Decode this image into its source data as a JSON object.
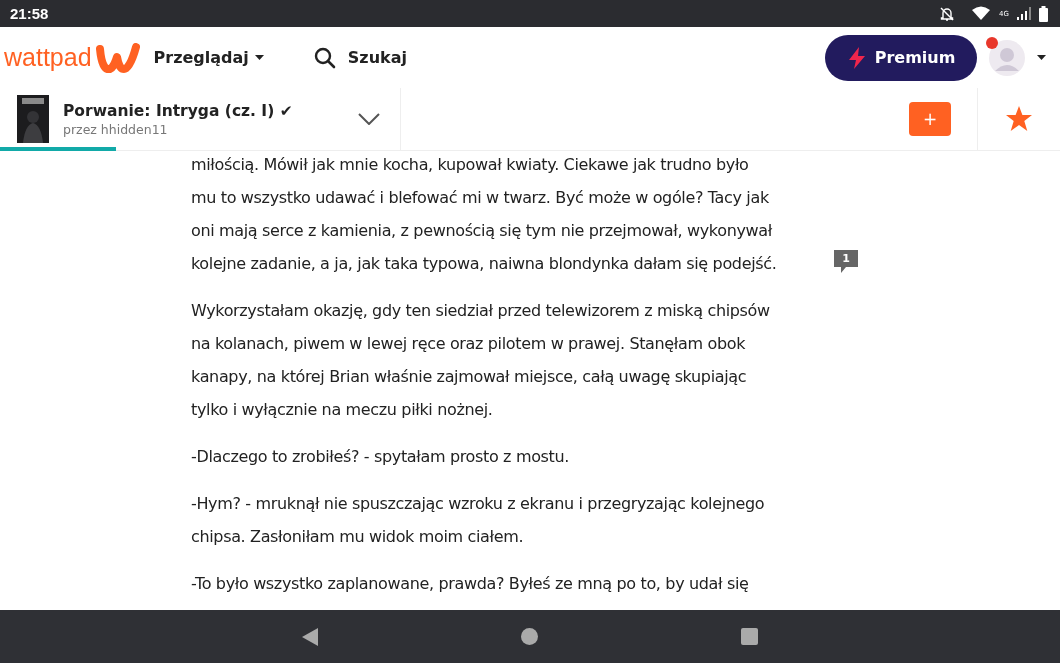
{
  "status_bar": {
    "time": "21:58",
    "network": "4G"
  },
  "header": {
    "logo": "wattpad",
    "browse": "Przeglądaj",
    "search": "Szukaj",
    "premium": "Premium",
    "notification": true
  },
  "story": {
    "title": "Porwanie: Intryga (cz. I)",
    "check": "✔",
    "author": "przez hhidden11",
    "progress": {
      "level": 0.29
    },
    "add": "+"
  },
  "paragraphs": [
    {
      "lines": [
        "miłością. Mówił jak mnie kocha, kupował kwiaty. Ciekawe jak trudno było",
        "mu to wszystko udawać i blefować mi w twarz. Być może w ogóle? Tacy jak",
        "oni mają serce z kamienia, z pewnością się tym nie przejmował, wykonywał",
        "kolejne zadanie, a ja, jak taka typowa, naiwna blondynka dałam się podejść."
      ],
      "comments": "1"
    },
    {
      "lines": [
        "Wykorzystałam okazję, gdy ten siedział przed telewizorem z miską chipsów",
        "na kolanach, piwem w lewej ręce oraz pilotem w prawej. Stanęłam obok",
        "kanapy, na której Brian właśnie zajmował miejsce, całą uwagę skupiając",
        "tylko i wyłącznie na meczu piłki nożnej."
      ]
    },
    {
      "lines": [
        "-Dlaczego to zrobiłeś? - spytałam prosto z mostu."
      ]
    },
    {
      "lines": [
        "-Hym? - mruknął nie spuszczając wzroku z ekranu i przegryzając kolejnego",
        "chipsa. Zasłoniłam mu widok moim ciałem."
      ]
    },
    {
      "lines": [
        "-To było wszystko zaplanowane, prawda? Byłeś ze mną po to, by udał się"
      ]
    }
  ]
}
